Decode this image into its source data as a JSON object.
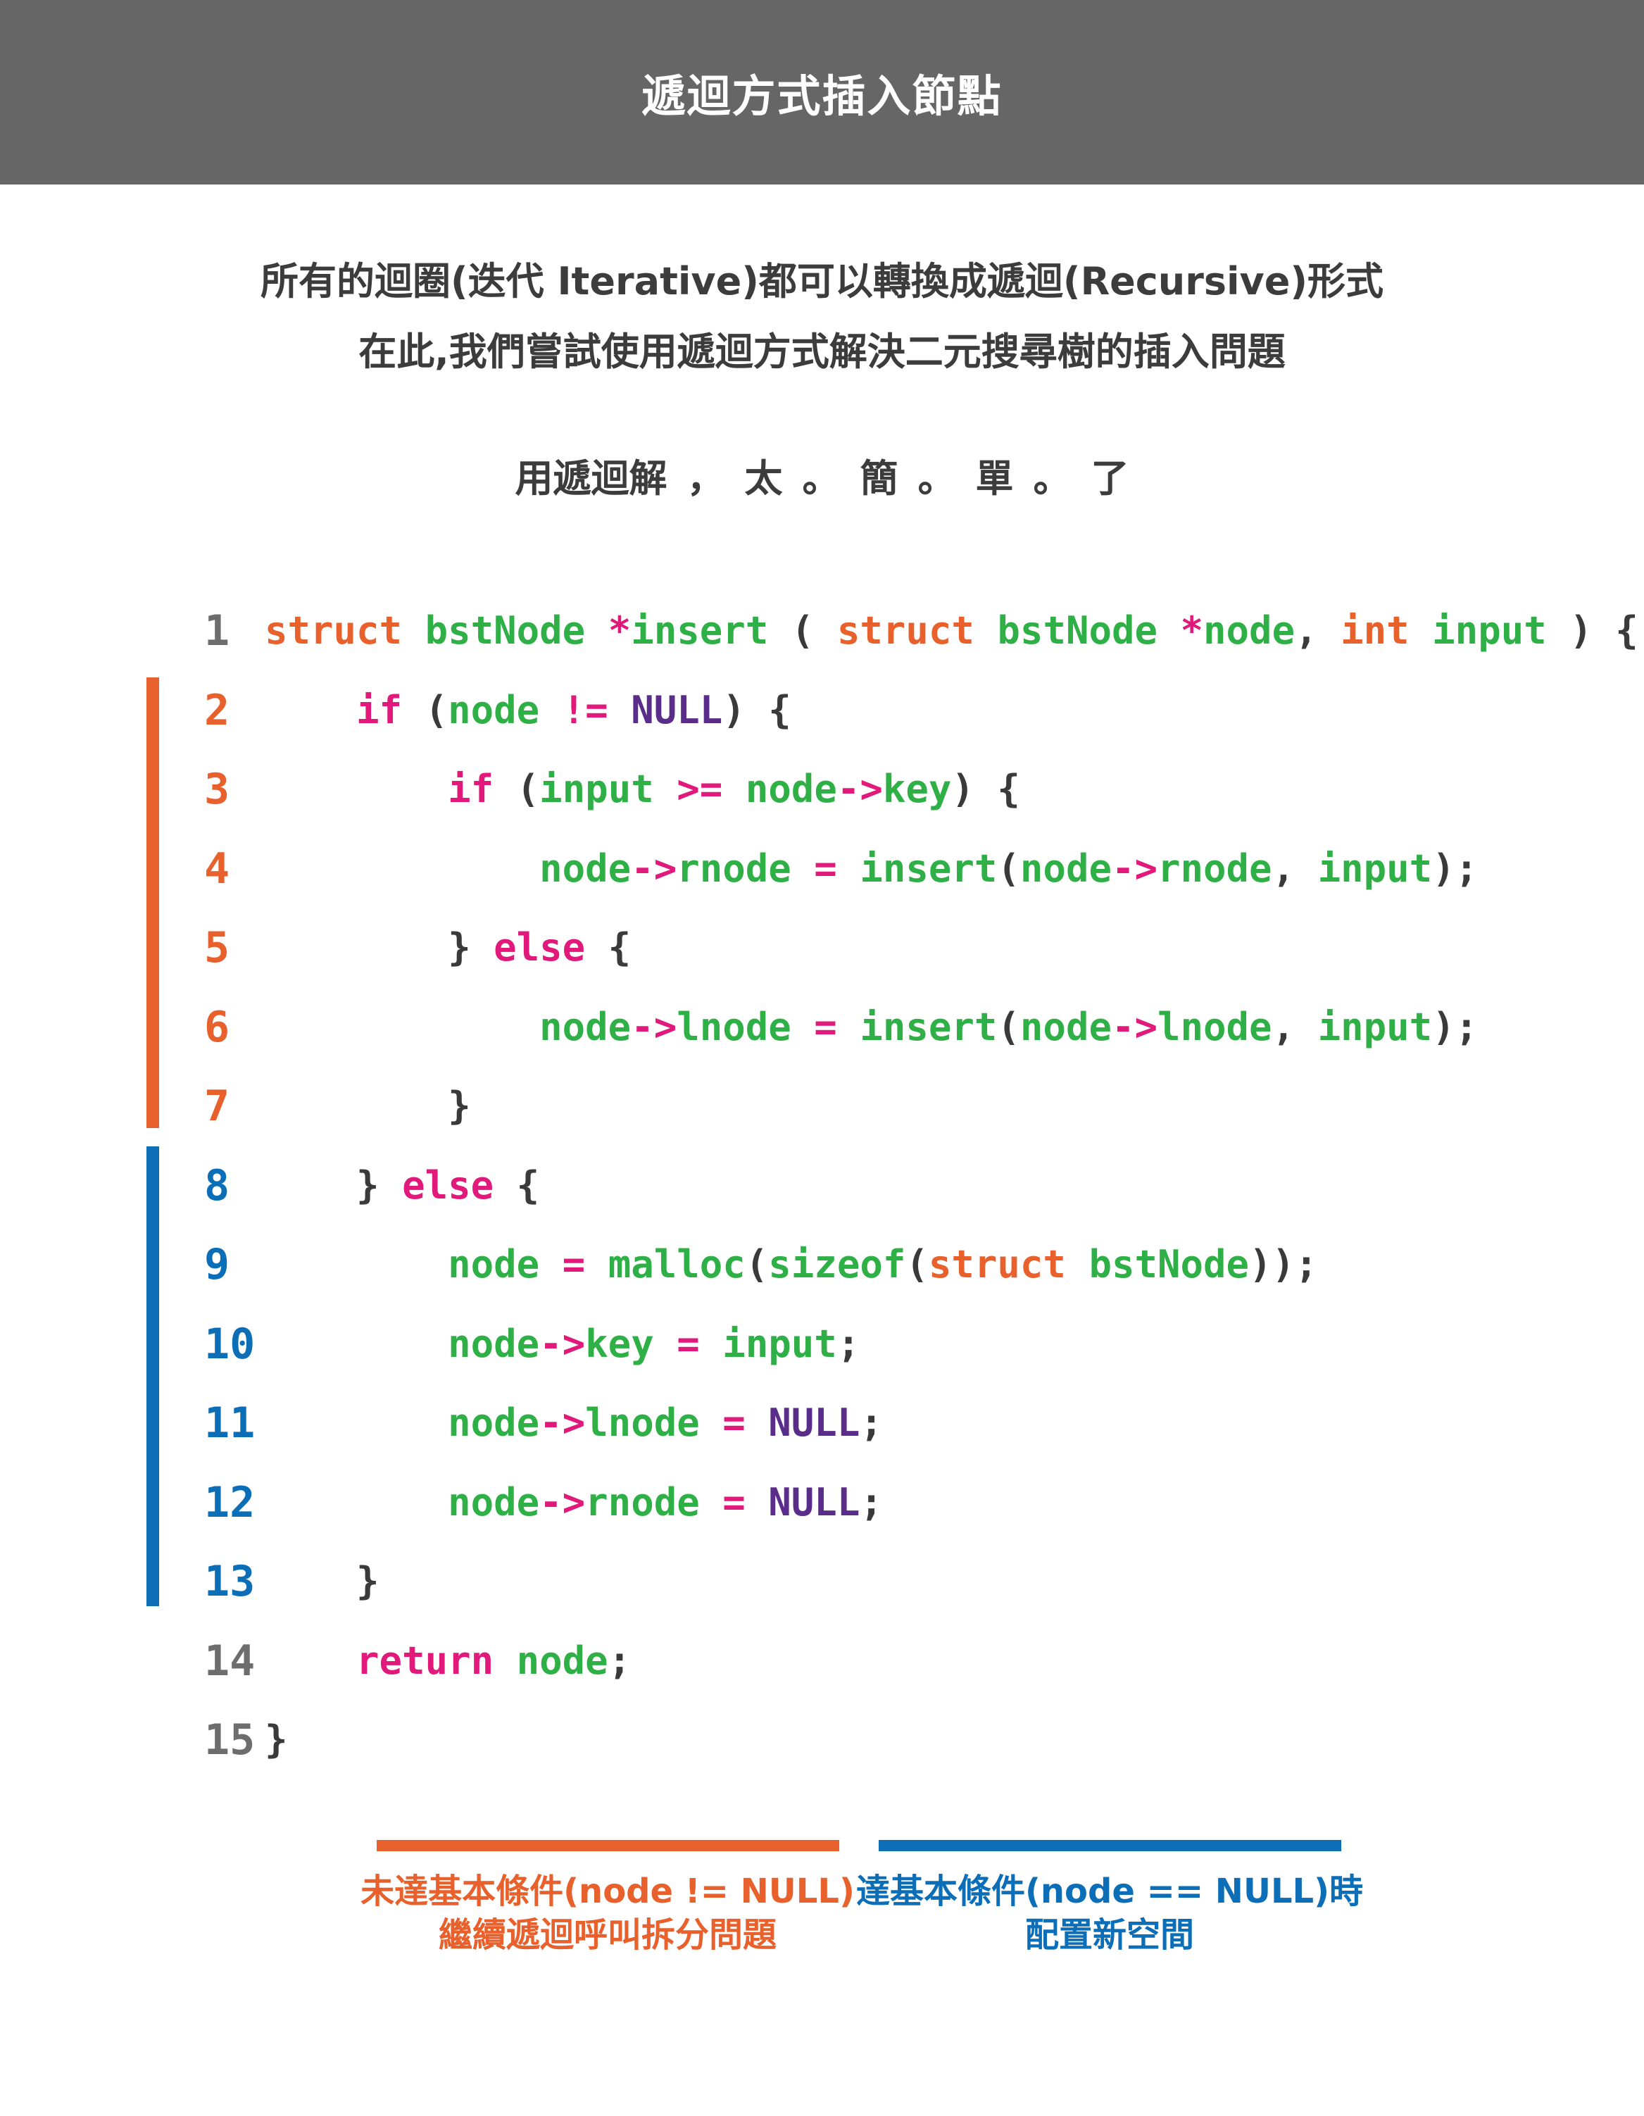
{
  "header": {
    "title": "遞迴方式插入節點"
  },
  "intro": {
    "line1": "所有的迴圈(迭代 Iterative)都可以轉換成遞迴(Recursive)形式",
    "line2": "在此,我們嘗試使用遞迴方式解決二元搜尋樹的插入問題",
    "tagline": [
      "用遞迴解",
      "，",
      "太",
      "。",
      "簡",
      "。",
      "單",
      "。",
      "了"
    ]
  },
  "code": {
    "line_numbers": [
      "1",
      "2",
      "3",
      "4",
      "5",
      "6",
      "7",
      "8",
      "9",
      "10",
      "11",
      "12",
      "13",
      "14",
      "15"
    ],
    "lines": [
      [
        [
          "kw",
          "struct"
        ],
        [
          "pn",
          " "
        ],
        [
          "fn",
          "bstNode"
        ],
        [
          "pn",
          " "
        ],
        [
          "op",
          "*"
        ],
        [
          "fn",
          "insert"
        ],
        [
          "pn",
          " ( "
        ],
        [
          "kw",
          "struct"
        ],
        [
          "pn",
          " "
        ],
        [
          "fn",
          "bstNode"
        ],
        [
          "pn",
          " "
        ],
        [
          "op",
          "*"
        ],
        [
          "fn",
          "node"
        ],
        [
          "pn",
          ", "
        ],
        [
          "kw",
          "int"
        ],
        [
          "pn",
          " "
        ],
        [
          "fn",
          "input"
        ],
        [
          "pn",
          " ) {"
        ]
      ],
      [
        [
          "pn",
          "    "
        ],
        [
          "op",
          "if"
        ],
        [
          "pn",
          " ("
        ],
        [
          "fn",
          "node"
        ],
        [
          "pn",
          " "
        ],
        [
          "op",
          "!="
        ],
        [
          "pn",
          " "
        ],
        [
          "nl",
          "NULL"
        ],
        [
          "pn",
          ") {"
        ]
      ],
      [
        [
          "pn",
          "        "
        ],
        [
          "op",
          "if"
        ],
        [
          "pn",
          " ("
        ],
        [
          "fn",
          "input"
        ],
        [
          "pn",
          " "
        ],
        [
          "op",
          ">="
        ],
        [
          "pn",
          " "
        ],
        [
          "fn",
          "node"
        ],
        [
          "op",
          "->"
        ],
        [
          "fn",
          "key"
        ],
        [
          "pn",
          ") {"
        ]
      ],
      [
        [
          "pn",
          "            "
        ],
        [
          "fn",
          "node"
        ],
        [
          "op",
          "->"
        ],
        [
          "fn",
          "rnode"
        ],
        [
          "pn",
          " "
        ],
        [
          "op",
          "="
        ],
        [
          "pn",
          " "
        ],
        [
          "fn",
          "insert"
        ],
        [
          "pn",
          "("
        ],
        [
          "fn",
          "node"
        ],
        [
          "op",
          "->"
        ],
        [
          "fn",
          "rnode"
        ],
        [
          "pn",
          ", "
        ],
        [
          "fn",
          "input"
        ],
        [
          "pn",
          ");"
        ]
      ],
      [
        [
          "pn",
          "        } "
        ],
        [
          "op",
          "else"
        ],
        [
          "pn",
          " {"
        ]
      ],
      [
        [
          "pn",
          "            "
        ],
        [
          "fn",
          "node"
        ],
        [
          "op",
          "->"
        ],
        [
          "fn",
          "lnode"
        ],
        [
          "pn",
          " "
        ],
        [
          "op",
          "="
        ],
        [
          "pn",
          " "
        ],
        [
          "fn",
          "insert"
        ],
        [
          "pn",
          "("
        ],
        [
          "fn",
          "node"
        ],
        [
          "op",
          "->"
        ],
        [
          "fn",
          "lnode"
        ],
        [
          "pn",
          ", "
        ],
        [
          "fn",
          "input"
        ],
        [
          "pn",
          ");"
        ]
      ],
      [
        [
          "pn",
          "        }"
        ]
      ],
      [
        [
          "pn",
          "    } "
        ],
        [
          "op",
          "else"
        ],
        [
          "pn",
          " {"
        ]
      ],
      [
        [
          "pn",
          "        "
        ],
        [
          "fn",
          "node"
        ],
        [
          "pn",
          " "
        ],
        [
          "op",
          "="
        ],
        [
          "pn",
          " "
        ],
        [
          "fn",
          "malloc"
        ],
        [
          "pn",
          "("
        ],
        [
          "fn",
          "sizeof"
        ],
        [
          "pn",
          "("
        ],
        [
          "kw",
          "struct"
        ],
        [
          "pn",
          " "
        ],
        [
          "fn",
          "bstNode"
        ],
        [
          "pn",
          "));"
        ]
      ],
      [
        [
          "pn",
          "        "
        ],
        [
          "fn",
          "node"
        ],
        [
          "op",
          "->"
        ],
        [
          "fn",
          "key"
        ],
        [
          "pn",
          " "
        ],
        [
          "op",
          "="
        ],
        [
          "pn",
          " "
        ],
        [
          "fn",
          "input"
        ],
        [
          "pn",
          ";"
        ]
      ],
      [
        [
          "pn",
          "        "
        ],
        [
          "fn",
          "node"
        ],
        [
          "op",
          "->"
        ],
        [
          "fn",
          "lnode"
        ],
        [
          "pn",
          " "
        ],
        [
          "op",
          "="
        ],
        [
          "pn",
          " "
        ],
        [
          "nl",
          "NULL"
        ],
        [
          "pn",
          ";"
        ]
      ],
      [
        [
          "pn",
          "        "
        ],
        [
          "fn",
          "node"
        ],
        [
          "op",
          "->"
        ],
        [
          "fn",
          "rnode"
        ],
        [
          "pn",
          " "
        ],
        [
          "op",
          "="
        ],
        [
          "pn",
          " "
        ],
        [
          "nl",
          "NULL"
        ],
        [
          "pn",
          ";"
        ]
      ],
      [
        [
          "pn",
          "    }"
        ]
      ],
      [
        [
          "pn",
          "    "
        ],
        [
          "op",
          "return"
        ],
        [
          "pn",
          " "
        ],
        [
          "fn",
          "node"
        ],
        [
          "pn",
          ";"
        ]
      ],
      [
        [
          "pn",
          "}"
        ]
      ]
    ]
  },
  "legend": {
    "recursive": {
      "line1": "未達基本條件(node != NULL)",
      "line2": "繼續遞迴呼叫拆分問題",
      "color": "#e8602c"
    },
    "base": {
      "line1": "達基本條件(node == NULL)時",
      "line2": "配置新空間",
      "color": "#0d6eb8"
    }
  }
}
